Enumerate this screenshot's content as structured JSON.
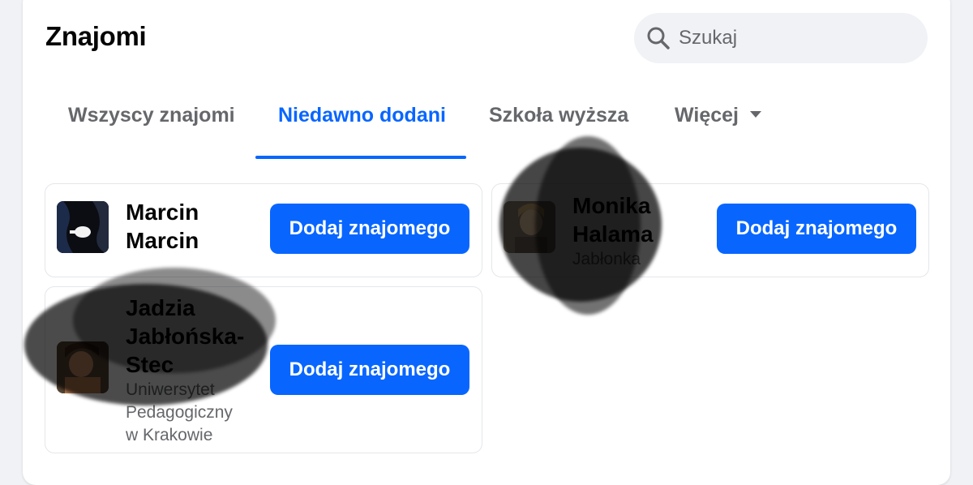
{
  "page": {
    "title": "Znajomi"
  },
  "search": {
    "placeholder": "Szukaj",
    "icon": "search-icon"
  },
  "tabs": [
    {
      "label": "Wszyscy znajomi",
      "active": false
    },
    {
      "label": "Niedawno dodani",
      "active": true
    },
    {
      "label": "Szkoła wyższa",
      "active": false
    },
    {
      "label": "Więcej",
      "active": false
    }
  ],
  "colors": {
    "accent": "#0866ff",
    "muted_text": "#65676b",
    "text": "#050505",
    "background": "#f0f2f5"
  },
  "friends": [
    {
      "name_line1": "Marcin",
      "name_line2": "Marcin",
      "subtitle": "",
      "button": "Dodaj znajomego"
    },
    {
      "name_line1": "Monika",
      "name_line2": "Halama",
      "subtitle": "Jabłonka",
      "button": "Dodaj znajomego"
    },
    {
      "name_line1": "Jadzia",
      "name_line2": "Jabłońska-",
      "name_line3": "Stec",
      "subtitle_line1": "Uniwersytet",
      "subtitle_line2": "Pedagogiczny",
      "subtitle_line3": "w Krakowie",
      "button": "Dodaj znajomego"
    }
  ]
}
